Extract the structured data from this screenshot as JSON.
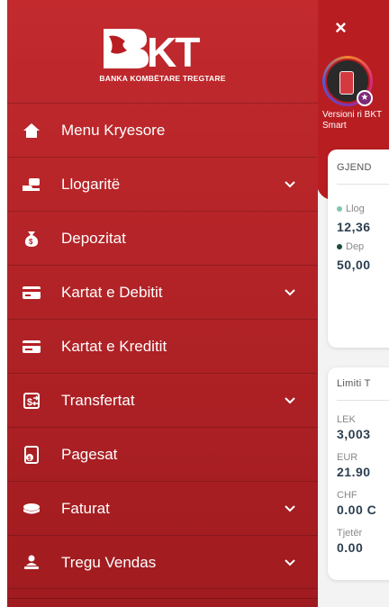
{
  "background": {
    "close_label": "×",
    "story_caption": "Versioni ri BKT Smart",
    "card1": {
      "title": "GJEND",
      "line1_label": "Llog",
      "line1_value": "12,36",
      "line2_label": "Dep",
      "line2_value": "50,00"
    },
    "card2": {
      "title": "Limiti T",
      "rows": [
        {
          "currency": "LEK",
          "value": "3,003"
        },
        {
          "currency": "EUR",
          "value": "21.90"
        },
        {
          "currency": "CHF",
          "value": "0.00 C"
        },
        {
          "currency": "Tjetër",
          "value": "0.00"
        }
      ]
    }
  },
  "brand": {
    "full_name": "BANKA KOMBËTARE TREGTARE",
    "logo_letters": "BKT"
  },
  "menu": [
    {
      "label": "Menu Kryesore",
      "icon": "home-icon",
      "expandable": false
    },
    {
      "label": "Llogaritë",
      "icon": "account-icon",
      "expandable": true
    },
    {
      "label": "Depozitat",
      "icon": "money-bag-icon",
      "expandable": false
    },
    {
      "label": "Kartat e Debitit",
      "icon": "debit-card-icon",
      "expandable": true
    },
    {
      "label": "Kartat e Kreditit",
      "icon": "credit-card-icon",
      "expandable": false
    },
    {
      "label": "Transfertat",
      "icon": "transfer-icon",
      "expandable": true
    },
    {
      "label": "Pagesat",
      "icon": "payment-icon",
      "expandable": false
    },
    {
      "label": "Faturat",
      "icon": "bills-icon",
      "expandable": true
    },
    {
      "label": "Tregu Vendas",
      "icon": "market-icon",
      "expandable": true
    }
  ],
  "colors": {
    "drawer_top": "#c22a2e",
    "drawer_bottom": "#a01b1f",
    "dot_light": "#7fc4b3",
    "dot_dark": "#1e4a3e"
  }
}
